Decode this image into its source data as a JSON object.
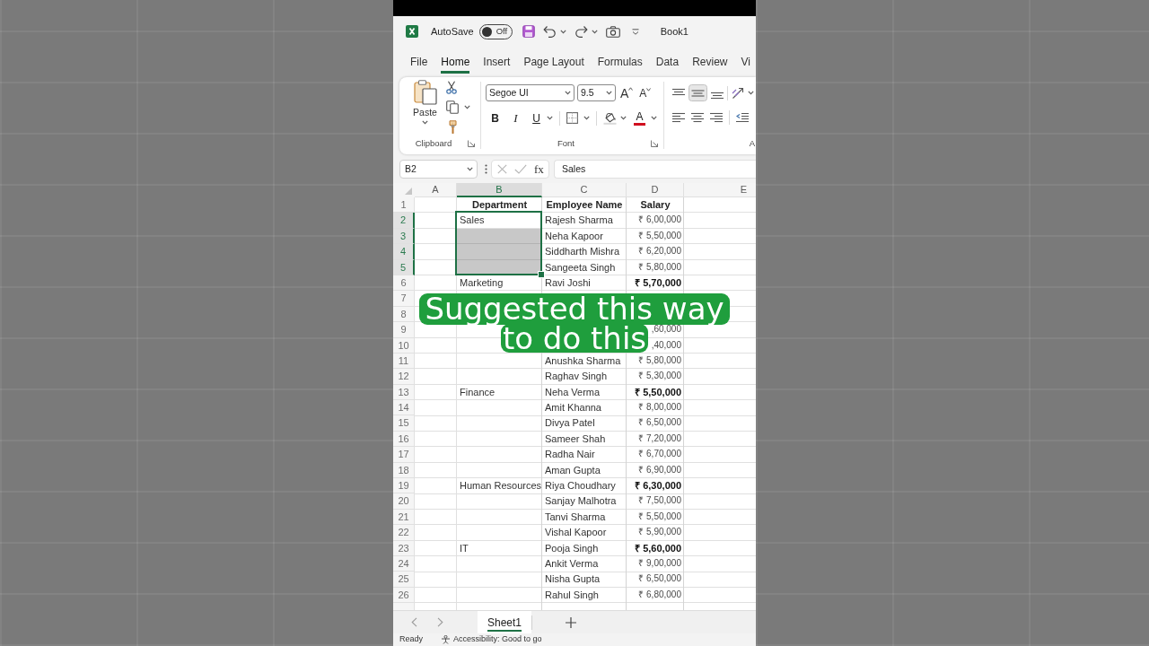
{
  "title_bar": {
    "autosave_label": "AutoSave",
    "autosave": {
      "label": "Off",
      "on": false
    },
    "document_title": "Book1"
  },
  "ribbon_tabs": [
    {
      "label": "File",
      "selected": false
    },
    {
      "label": "Home",
      "selected": true
    },
    {
      "label": "Insert",
      "selected": false
    },
    {
      "label": "Page Layout",
      "selected": false
    },
    {
      "label": "Formulas",
      "selected": false
    },
    {
      "label": "Data",
      "selected": false
    },
    {
      "label": "Review",
      "selected": false
    },
    {
      "label": "Vi",
      "selected": false
    }
  ],
  "ribbon": {
    "clipboard": {
      "paste_label": "Paste",
      "group_label": "Clipboard"
    },
    "font": {
      "font_name": "Segoe UI",
      "font_size": "9.5",
      "grow_label": "A",
      "shrink_label": "A",
      "format_buttons": [
        {
          "kind": "bold",
          "label": "B"
        },
        {
          "kind": "italic",
          "label": "I"
        },
        {
          "kind": "underline",
          "label": "U"
        }
      ],
      "font_color_label": "A",
      "group_label": "Font"
    },
    "alignment": {
      "buttons": [
        {
          "kind": "top",
          "selected": false
        },
        {
          "kind": "middle",
          "selected": true
        },
        {
          "kind": "bottom",
          "selected": false
        },
        {
          "kind": "left",
          "selected": false
        },
        {
          "kind": "center",
          "selected": false
        },
        {
          "kind": "right",
          "selected": false
        }
      ],
      "group_label": "A"
    }
  },
  "formula_bar": {
    "name_box": "B2",
    "function_label": "fx",
    "formula": "Sales"
  },
  "sheet": {
    "columns": [
      {
        "label": "A",
        "selected": false
      },
      {
        "label": "B",
        "selected": true
      },
      {
        "label": "C",
        "selected": false
      },
      {
        "label": "D",
        "selected": false
      },
      {
        "label": "E",
        "selected": false
      }
    ],
    "rows": [
      {
        "number": "1",
        "kind": "header",
        "selected": false,
        "department": "Department",
        "employee": "Employee Name",
        "salary": "Salary"
      },
      {
        "number": "2",
        "kind": "data",
        "selected": true,
        "department": "Sales",
        "department_shaded": false,
        "employee": "Rajesh Sharma",
        "salary": "₹ 6,00,000",
        "salary_bold": false
      },
      {
        "number": "3",
        "kind": "data",
        "selected": true,
        "department_shaded": true,
        "employee": "Neha Kapoor",
        "salary": "₹ 5,50,000",
        "salary_bold": false
      },
      {
        "number": "4",
        "kind": "data",
        "selected": true,
        "department_shaded": true,
        "employee": "Siddharth Mishra",
        "salary": "₹ 6,20,000",
        "salary_bold": false
      },
      {
        "number": "5",
        "kind": "data",
        "selected": true,
        "department_shaded": true,
        "employee": "Sangeeta Singh",
        "salary": "₹ 5,80,000",
        "salary_bold": false
      },
      {
        "number": "6",
        "kind": "data",
        "selected": false,
        "department": "Marketing",
        "department_shaded": false,
        "employee": "Ravi Joshi",
        "salary": "₹ 5,70,000",
        "salary_bold": true
      },
      {
        "number": "7",
        "kind": "data",
        "selected": false
      },
      {
        "number": "8",
        "kind": "data",
        "selected": false
      },
      {
        "number": "9",
        "kind": "data",
        "selected": false,
        "department_shaded": false,
        "salary": ",60,000",
        "salary_bold": false
      },
      {
        "number": "10",
        "kind": "data",
        "selected": false,
        "department_shaded": false,
        "salary": ",40,000",
        "salary_bold": false
      },
      {
        "number": "11",
        "kind": "data",
        "selected": false,
        "department_shaded": false,
        "employee": "Anushka Sharma",
        "salary": "₹ 5,80,000",
        "salary_bold": false
      },
      {
        "number": "12",
        "kind": "data",
        "selected": false,
        "department_shaded": false,
        "employee": "Raghav Singh",
        "salary": "₹ 5,30,000",
        "salary_bold": false
      },
      {
        "number": "13",
        "kind": "data",
        "selected": false,
        "department": "Finance",
        "department_shaded": false,
        "employee": "Neha Verma",
        "salary": "₹ 5,50,000",
        "salary_bold": true
      },
      {
        "number": "14",
        "kind": "data",
        "selected": false,
        "department_shaded": false,
        "employee": "Amit Khanna",
        "salary": "₹ 8,00,000",
        "salary_bold": false
      },
      {
        "number": "15",
        "kind": "data",
        "selected": false,
        "department_shaded": false,
        "employee": "Divya Patel",
        "salary": "₹ 6,50,000",
        "salary_bold": false
      },
      {
        "number": "16",
        "kind": "data",
        "selected": false,
        "department_shaded": false,
        "employee": "Sameer Shah",
        "salary": "₹ 7,20,000",
        "salary_bold": false
      },
      {
        "number": "17",
        "kind": "data",
        "selected": false,
        "department_shaded": false,
        "employee": "Radha Nair",
        "salary": "₹ 6,70,000",
        "salary_bold": false
      },
      {
        "number": "18",
        "kind": "data",
        "selected": false,
        "department_shaded": false,
        "employee": "Aman Gupta",
        "salary": "₹ 6,90,000",
        "salary_bold": false
      },
      {
        "number": "19",
        "kind": "data",
        "selected": false,
        "department": "Human Resources",
        "department_shaded": false,
        "employee": "Riya Choudhary",
        "salary": "₹ 6,30,000",
        "salary_bold": true
      },
      {
        "number": "20",
        "kind": "data",
        "selected": false,
        "department_shaded": false,
        "employee": "Sanjay Malhotra",
        "salary": "₹ 7,50,000",
        "salary_bold": false
      },
      {
        "number": "21",
        "kind": "data",
        "selected": false,
        "department_shaded": false,
        "employee": "Tanvi Sharma",
        "salary": "₹ 5,50,000",
        "salary_bold": false
      },
      {
        "number": "22",
        "kind": "data",
        "selected": false,
        "department_shaded": false,
        "employee": "Vishal Kapoor",
        "salary": "₹ 5,90,000",
        "salary_bold": false
      },
      {
        "number": "23",
        "kind": "data",
        "selected": false,
        "department": "IT",
        "department_shaded": false,
        "employee": "Pooja Singh",
        "salary": "₹ 5,60,000",
        "salary_bold": true
      },
      {
        "number": "24",
        "kind": "data",
        "selected": false,
        "department_shaded": false,
        "employee": "Ankit Verma",
        "salary": "₹ 9,00,000",
        "salary_bold": false
      },
      {
        "number": "25",
        "kind": "data",
        "selected": false,
        "department_shaded": false,
        "employee": "Nisha Gupta",
        "salary": "₹ 6,50,000",
        "salary_bold": false
      },
      {
        "number": "26",
        "kind": "data",
        "selected": false,
        "department_shaded": false,
        "employee": "Rahul Singh",
        "salary": "₹ 6,80,000",
        "salary_bold": false
      }
    ]
  },
  "caption": {
    "lines": [
      "Suggested this way",
      "to do this"
    ]
  },
  "sheet_tabs": [
    {
      "label": "Sheet1",
      "selected": true
    }
  ],
  "status_bar": {
    "status": "Ready",
    "accessibility": "Accessibility: Good to go"
  }
}
